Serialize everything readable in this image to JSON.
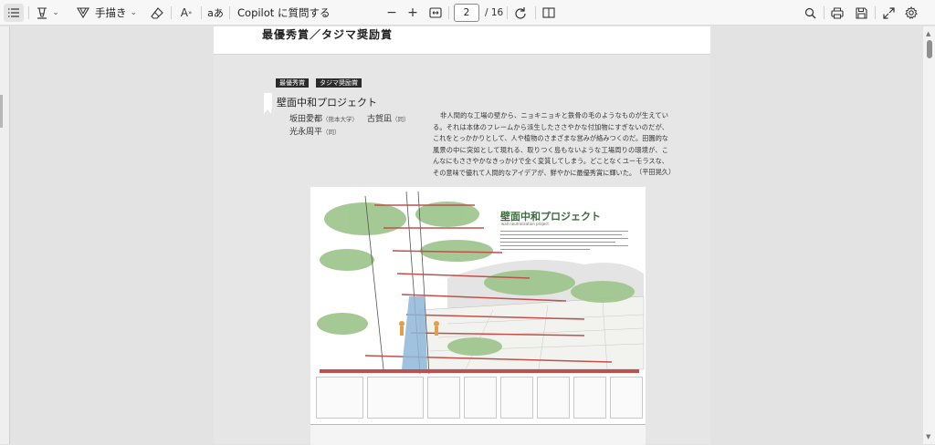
{
  "toolbar": {
    "handwriting_label": "手描き",
    "copilot_label": "Copilot に質問する",
    "current_page": "2",
    "total_pages": "/ 16",
    "text_format_glyph": "A",
    "read_aloud_glyph": "aあ",
    "icons": [
      "contents-icon",
      "highlight-icon",
      "draw-icon",
      "eraser-icon",
      "text-format-icon",
      "read-aloud-icon",
      "zoom-out-icon",
      "zoom-in-icon",
      "fit-page-icon",
      "rotate-icon",
      "two-page-icon",
      "search-icon",
      "print-icon",
      "save-icon",
      "fullscreen-icon",
      "settings-icon"
    ]
  },
  "document": {
    "section_heading": "最優秀賞／タジマ奨励賞",
    "tags": [
      "最優秀賞",
      "タジマ奨励賞"
    ],
    "project_title": "壁面中和プロジェクト",
    "authors": [
      {
        "name": "坂田愛都",
        "affiliation": "（熊本大学）"
      },
      {
        "name": "古賀凪",
        "affiliation": "（同）"
      },
      {
        "name": "光永周平",
        "affiliation": "（同）"
      }
    ],
    "description": "非人間的な工場の壁から、ニョキニョキと鉄骨の毛のようなものが生えている。それは本体のフレームから派生したささやかな付加物にすぎないのだが、これをとっかかりとして、人や植物のさまざまな営みが絡みつくのだ。田園的な風景の中に突如として現れる、取りつく島もないような工場周りの環境が、こんなにもささやかなきっかけで全く変質してしまう。どことなくユーモラスな、その意味で優れて人間的なアイデアが、鮮やかに最優秀賞に輝いた。",
    "credit": "（平田晃久）",
    "poster": {
      "title": "壁面中和プロジェクト",
      "subtitle": "wall neutralization project"
    }
  }
}
